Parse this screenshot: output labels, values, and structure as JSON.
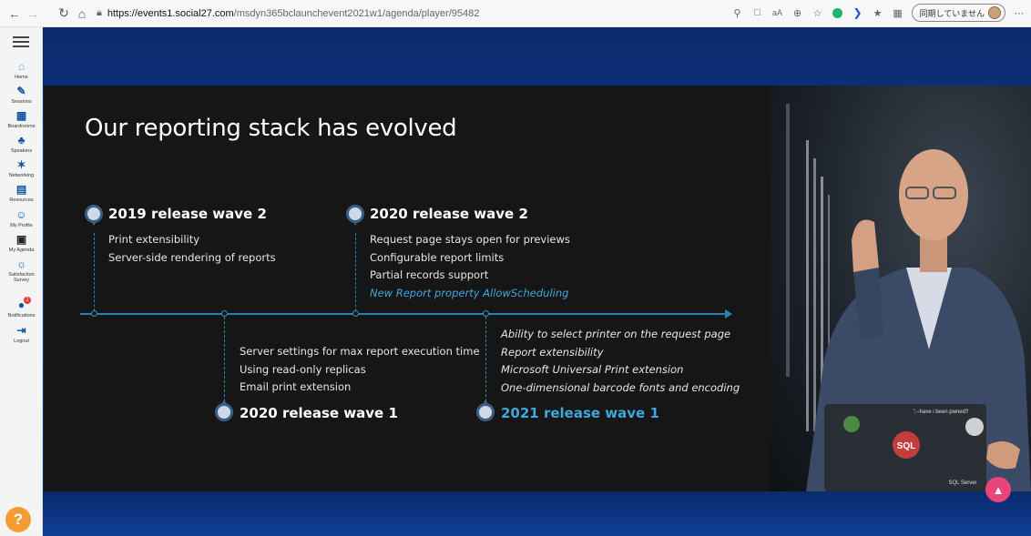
{
  "browser": {
    "url_host": "https://events1.social27.com",
    "url_path": "/msdyn365bclaunchevent2021w1/agenda/player/95482",
    "sync_label": "同期していません"
  },
  "sidebar": {
    "items": [
      {
        "label": "Home",
        "icon": "home-icon"
      },
      {
        "label": "Sessions",
        "icon": "pencil-icon"
      },
      {
        "label": "Boardrooms",
        "icon": "boardroom-icon"
      },
      {
        "label": "Speakers",
        "icon": "speaker-icon"
      },
      {
        "label": "Networking",
        "icon": "network-icon"
      },
      {
        "label": "Resources",
        "icon": "resources-icon"
      },
      {
        "label": "My Profile",
        "icon": "profile-icon"
      },
      {
        "label": "My Agenda",
        "icon": "calendar-icon"
      },
      {
        "label": "Satisfaction Survey",
        "icon": "survey-icon"
      },
      {
        "label": "Notifications",
        "icon": "bell-icon"
      },
      {
        "label": "Logout",
        "icon": "logout-icon"
      }
    ],
    "notification_count": "1",
    "help_label": "?"
  },
  "slide": {
    "title": "Our reporting stack has evolved",
    "waves": [
      {
        "title": "2019 release wave 2",
        "features": [
          "Print extensibility",
          "Server-side rendering of reports"
        ]
      },
      {
        "title": "2020 release wave 1",
        "features": [
          "Server settings for max report execution time",
          "Using read-only replicas",
          "Email print extension"
        ]
      },
      {
        "title": "2020 release wave 2",
        "features": [
          "Request page stays open for previews",
          "Configurable report limits",
          "Partial records support",
          "New Report property AllowScheduling"
        ]
      },
      {
        "title": "2021 release wave 1",
        "features": [
          "Ability to select printer on the request page",
          "Report extensibility",
          "Microsoft Universal Print extension",
          "One-dimensional barcode fonts and encoding"
        ]
      }
    ]
  },
  "video": {
    "laptop_sticker": "SQL",
    "laptop_caption": "';--have i been pwned?",
    "laptop_brand": "SQL Server"
  },
  "colors": {
    "accent": "#3fa7dd",
    "slide_bg": "#161616",
    "stage_bg": "#0e3a8f",
    "like": "#e8457a",
    "help": "#f39c33"
  }
}
